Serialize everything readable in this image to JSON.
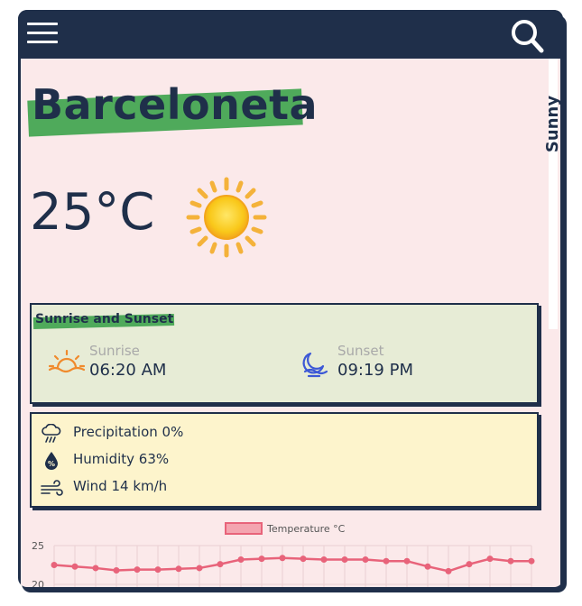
{
  "header": {
    "menu_icon": "hamburger-menu-icon",
    "search_icon": "search-icon"
  },
  "location": {
    "name": "Barceloneta"
  },
  "current": {
    "temperature": "25°C",
    "condition": "Sunny",
    "icon": "sun-icon"
  },
  "sun_card": {
    "title": "Sunrise and Sunset",
    "sunrise": {
      "label": "Sunrise",
      "time": "06:20 AM",
      "icon": "sunrise-icon"
    },
    "sunset": {
      "label": "Sunset",
      "time": "09:19 PM",
      "icon": "sunset-icon"
    }
  },
  "details": {
    "precipitation": {
      "text": "Precipitation 0%",
      "icon": "rain-cloud-icon"
    },
    "humidity": {
      "text": "Humidity 63%",
      "icon": "humidity-drop-icon"
    },
    "wind": {
      "text": "Wind 14 km/h",
      "icon": "wind-icon"
    }
  },
  "colors": {
    "primary": "#1f2f4a",
    "background": "#fbe9ea",
    "highlight": "#4faa5b",
    "sun_card_bg": "#e7ecd6",
    "info_card_bg": "#fdf4cc",
    "chart_line": "#e8637a"
  },
  "chart_data": {
    "type": "line",
    "series": [
      {
        "name": "Temperature °C",
        "values": [
          22.5,
          22.3,
          22.1,
          21.8,
          21.9,
          21.9,
          22.0,
          22.1,
          22.6,
          23.2,
          23.3,
          23.4,
          23.3,
          23.2,
          23.2,
          23.2,
          23.0,
          23.0,
          22.3,
          21.7,
          22.6,
          23.3,
          23.0,
          23.0
        ]
      }
    ],
    "y_ticks": [
      "25",
      "20"
    ],
    "ylim": [
      20,
      25
    ],
    "legend_position": "top-center",
    "grid": true
  }
}
